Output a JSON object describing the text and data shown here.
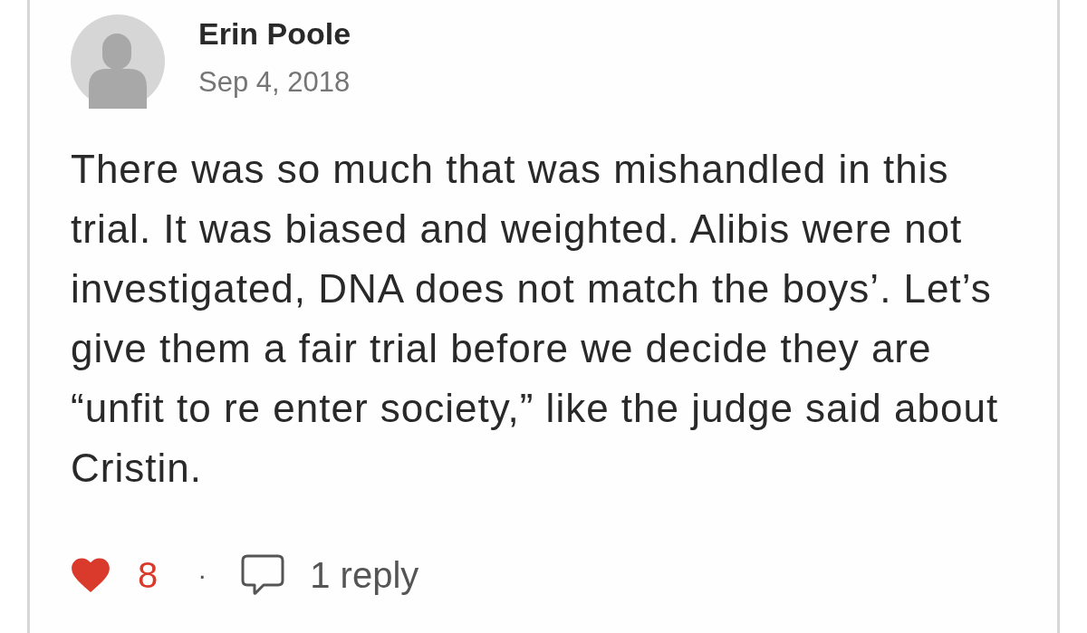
{
  "comment": {
    "author": "Erin Poole",
    "date": "Sep 4, 2018",
    "body": "There was so much that was mishandled in this trial. It was biased and weighted. Alibis were not investigated, DNA does not match the boys’. Let’s give them a fair trial before we decide they are “unfit to re enter society,” like the judge said about Cristin.",
    "likes": {
      "count": "8",
      "liked": true
    },
    "separator": "·",
    "replies": "1 reply"
  }
}
